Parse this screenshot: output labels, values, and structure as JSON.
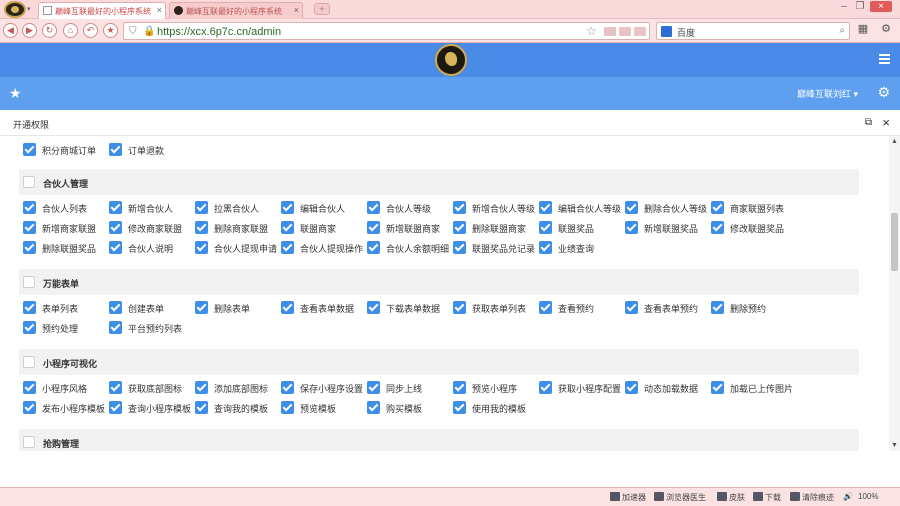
{
  "browser": {
    "tabs": [
      {
        "title": "巅峰互联最好的小程序系统",
        "active": true
      },
      {
        "title": "巅峰互联最好的小程序系统",
        "active": false
      }
    ],
    "url": "https://xcx.6p7c.cn/admin",
    "search_engine": "百度",
    "status_items": [
      "加速器",
      "浏览器医生",
      "皮肤",
      "下载",
      "清除痕迹",
      "100%"
    ]
  },
  "header": {
    "user_name": "巅峰互联刘红",
    "icons": {
      "menu": "hamburger-icon",
      "favorite": "star-icon",
      "settings": "gear-icon"
    }
  },
  "modal": {
    "title": "开通权限",
    "top_items": [
      "积分商城订单",
      "订单退款"
    ],
    "sections": [
      {
        "title": "合伙人管理",
        "items": [
          "合伙人列表",
          "新增合伙人",
          "拉黑合伙人",
          "编辑合伙人",
          "合伙人等级",
          "新增合伙人等级",
          "编辑合伙人等级",
          "删除合伙人等级",
          "商家联盟列表",
          "新增商家联盟",
          "修改商家联盟",
          "删除商家联盟",
          "联盟商家",
          "新增联盟商家",
          "删除联盟商家",
          "联盟奖品",
          "新增联盟奖品",
          "修改联盟奖品",
          "删除联盟奖品",
          "合伙人说明",
          "合伙人提现申请",
          "合伙人提现操作",
          "合伙人余额明细",
          "联盟奖品兑记录",
          "业绩查询"
        ]
      },
      {
        "title": "万能表单",
        "items": [
          "表单列表",
          "创建表单",
          "删除表单",
          "查看表单数据",
          "下载表单数据",
          "获取表单列表",
          "查看预约",
          "查看表单预约",
          "删除预约",
          "预约处理",
          "平台预约列表"
        ]
      },
      {
        "title": "小程序可视化",
        "items": [
          "小程序风格",
          "获取底部图标",
          "添加底部图标",
          "保存小程序设置",
          "同步上线",
          "预览小程序",
          "获取小程序配置",
          "动态加载数据",
          "加载已上传图片",
          "发布小程序模板",
          "查询小程序模板",
          "查询我的模板",
          "预览模板",
          "购买模板",
          "使用我的模板"
        ]
      },
      {
        "title": "抢购管理",
        "items": []
      }
    ]
  }
}
